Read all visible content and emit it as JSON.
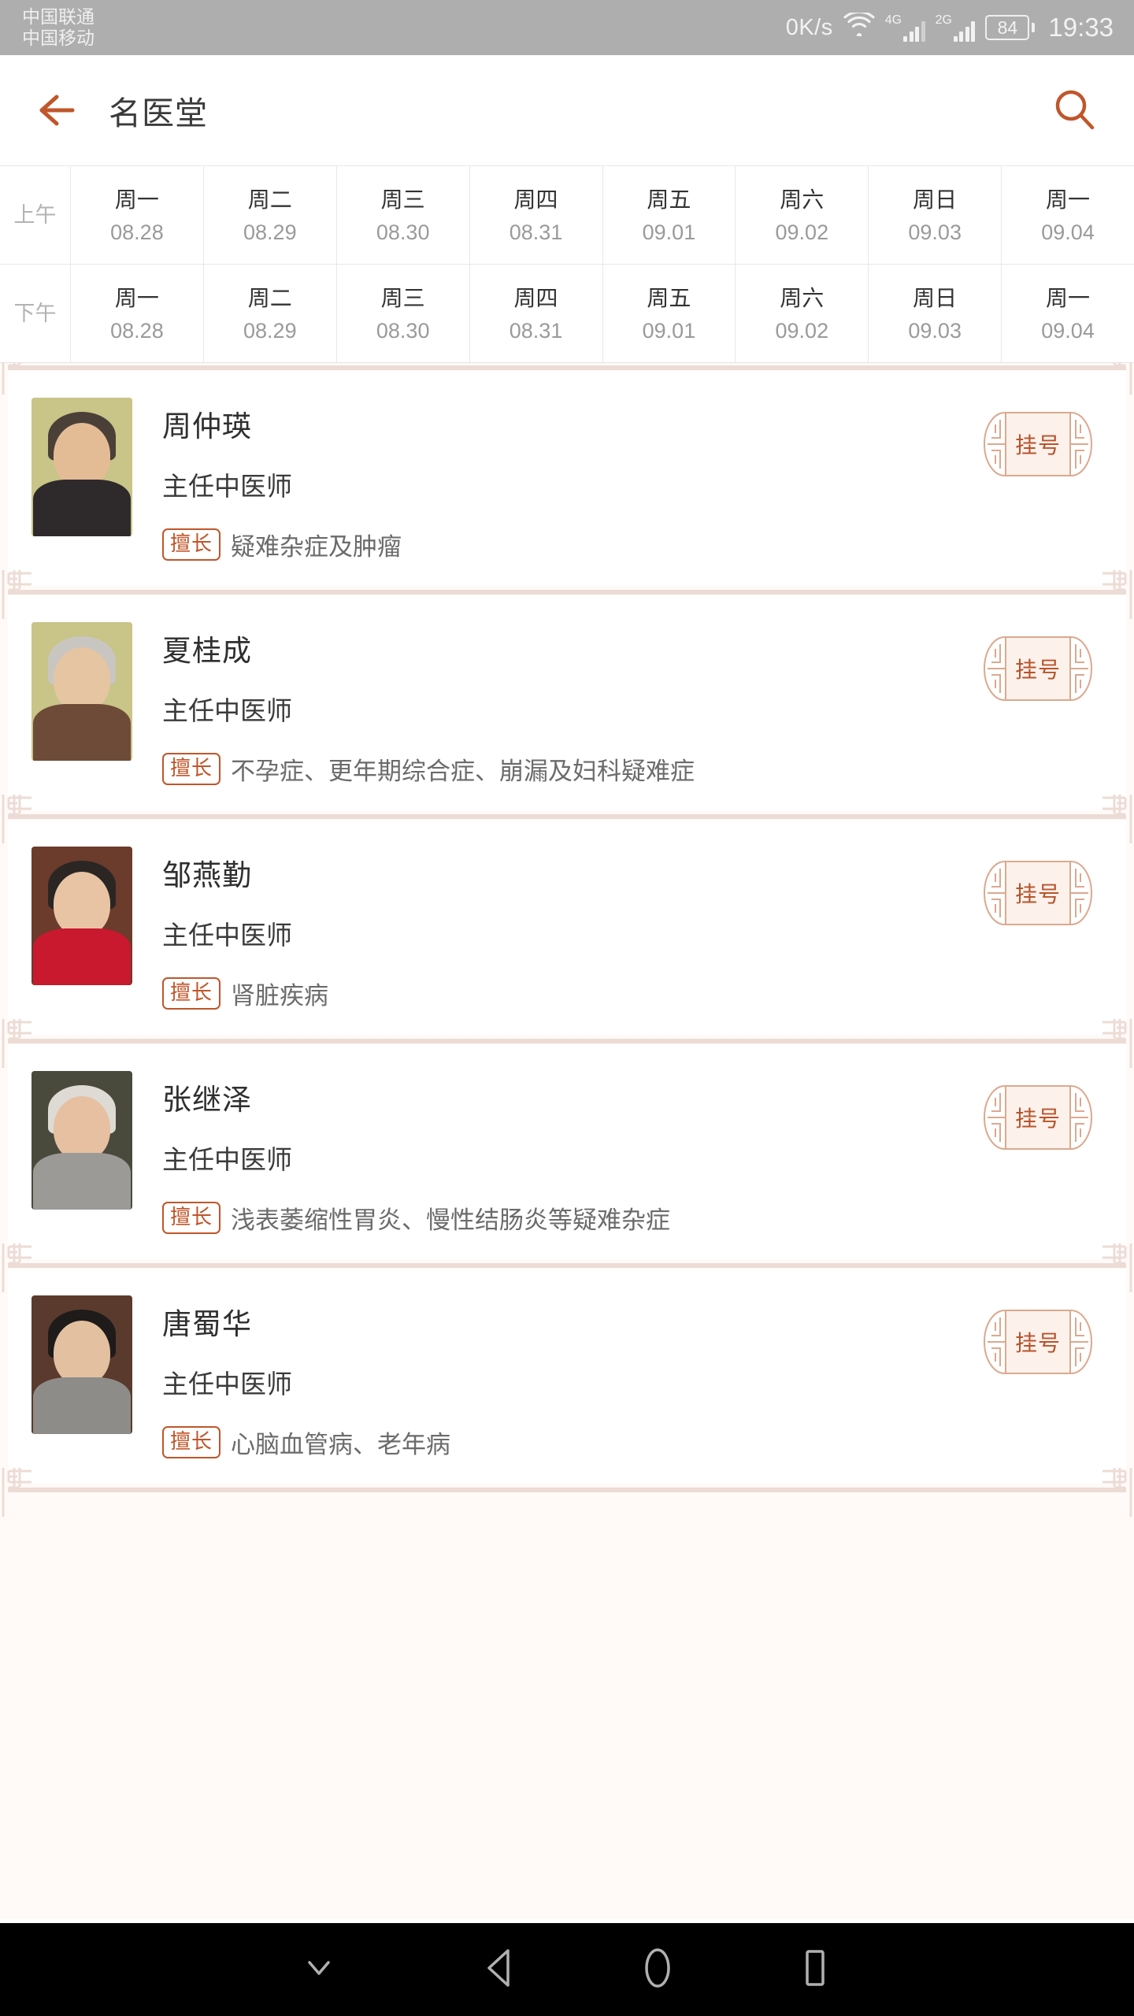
{
  "statusbar": {
    "carrier_primary": "中国联通",
    "carrier_secondary": "中国移动",
    "net_speed": "0K/s",
    "wifi_icon": "wifi-icon",
    "sim1_network": "4G",
    "sim2_network": "2G",
    "battery_level": "84",
    "time": "19:33"
  },
  "header": {
    "back_icon": "back-arrow-icon",
    "title": "名医堂",
    "search_icon": "search-icon"
  },
  "schedule": {
    "rows": [
      {
        "period": "上午",
        "cells": [
          {
            "day": "周一",
            "date": "08.28"
          },
          {
            "day": "周二",
            "date": "08.29"
          },
          {
            "day": "周三",
            "date": "08.30"
          },
          {
            "day": "周四",
            "date": "08.31"
          },
          {
            "day": "周五",
            "date": "09.01"
          },
          {
            "day": "周六",
            "date": "09.02"
          },
          {
            "day": "周日",
            "date": "09.03"
          },
          {
            "day": "周一",
            "date": "09.04"
          }
        ]
      },
      {
        "period": "下午",
        "cells": [
          {
            "day": "周一",
            "date": "08.28"
          },
          {
            "day": "周二",
            "date": "08.29"
          },
          {
            "day": "周三",
            "date": "08.30"
          },
          {
            "day": "周四",
            "date": "08.31"
          },
          {
            "day": "周五",
            "date": "09.01"
          },
          {
            "day": "周六",
            "date": "09.02"
          },
          {
            "day": "周日",
            "date": "09.03"
          },
          {
            "day": "周一",
            "date": "09.04"
          }
        ]
      }
    ]
  },
  "doctors": {
    "specialty_tag_label": "擅长",
    "register_button_label": "挂号",
    "items": [
      {
        "name": "周仲瑛",
        "title": "主任中医师",
        "specialty": "疑难杂症及肿瘤",
        "photo_bg": "#c9c487",
        "photo_hair": "#4a4038",
        "photo_skin": "#e3bc96",
        "photo_body": "#2e2a2c"
      },
      {
        "name": "夏桂成",
        "title": "主任中医师",
        "specialty": "不孕症、更年期综合症、崩漏及妇科疑难症",
        "photo_bg": "#c9c487",
        "photo_hair": "#c9c6c2",
        "photo_skin": "#e6c5a2",
        "photo_body": "#6e4a38"
      },
      {
        "name": "邹燕勤",
        "title": "主任中医师",
        "specialty": "肾脏疾病",
        "photo_bg": "#6b3b2c",
        "photo_hair": "#2b2623",
        "photo_skin": "#e8c4a5",
        "photo_body": "#c8192e"
      },
      {
        "name": "张继泽",
        "title": "主任中医师",
        "specialty": "浅表萎缩性胃炎、慢性结肠炎等疑难杂症",
        "photo_bg": "#4a4a3c",
        "photo_hair": "#dedad4",
        "photo_skin": "#e6c0a0",
        "photo_body": "#9b9a97"
      },
      {
        "name": "唐蜀华",
        "title": "主任中医师",
        "specialty": "心脑血管病、老年病",
        "photo_bg": "#5a3a2c",
        "photo_hair": "#1e1b1a",
        "photo_skin": "#e3c0a0",
        "photo_body": "#8e8c88"
      }
    ]
  },
  "navbar": {
    "hide_icon": "chevron-down-icon",
    "back_icon": "triangle-back-icon",
    "home_icon": "circle-home-icon",
    "recents_icon": "square-recents-icon"
  },
  "colors": {
    "accent": "#c0562a",
    "ornament": "#ecdcd5",
    "page_bg": "#fffaf7"
  }
}
